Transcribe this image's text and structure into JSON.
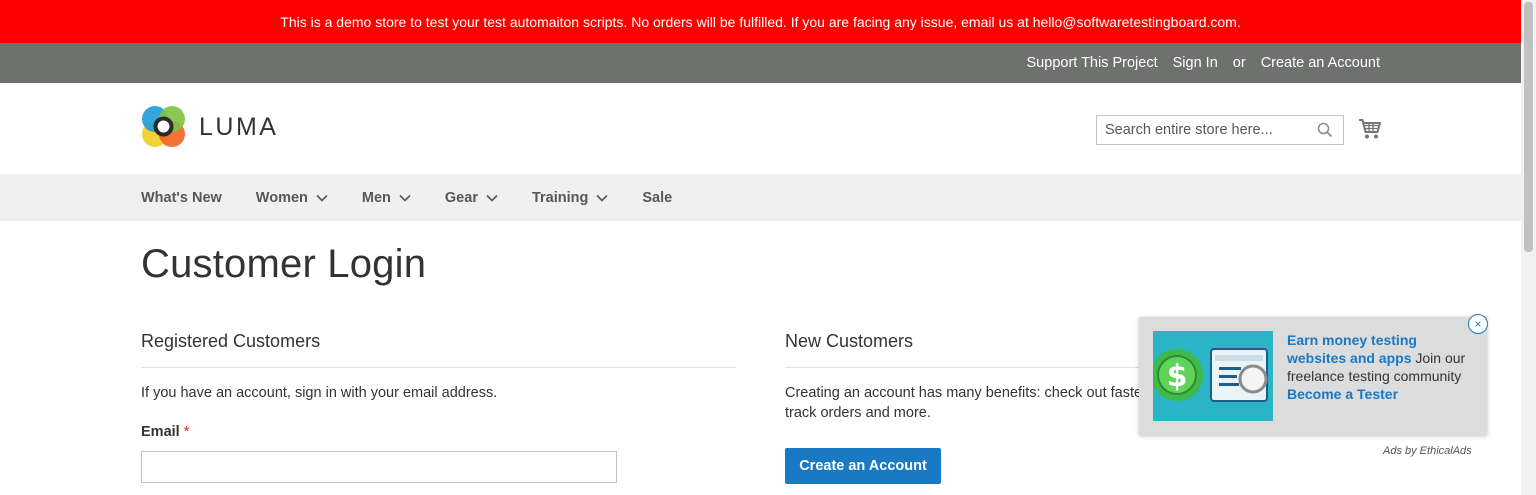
{
  "demo_notice": "This is a demo store to test your test automaiton scripts. No orders will be fulfilled. If you are facing any issue, email us at hello@softwaretestingboard.com.",
  "header_links": {
    "support": "Support This Project",
    "sign_in": "Sign In",
    "or": "or",
    "create_account": "Create an Account"
  },
  "logo": {
    "text": "LUMA"
  },
  "search": {
    "placeholder": "Search entire store here..."
  },
  "nav": {
    "items": [
      {
        "label": "What's New"
      },
      {
        "label": "Women"
      },
      {
        "label": "Men"
      },
      {
        "label": "Gear"
      },
      {
        "label": "Training"
      },
      {
        "label": "Sale"
      }
    ]
  },
  "page_title": "Customer Login",
  "registered": {
    "title": "Registered Customers",
    "intro": "If you have an account, sign in with your email address.",
    "email_label": "Email",
    "required_mark": "*"
  },
  "new_customers": {
    "title": "New Customers",
    "text": "Creating an account has many benefits: check out faste",
    "text_line2": "track orders and more.",
    "button": "Create an Account"
  },
  "ad": {
    "link_text": "Earn money testing websites and apps",
    "body": " Join our freelance testing community ",
    "cta": "Become a Tester",
    "close": "×",
    "attribution": "Ads by EthicalAds"
  },
  "colors": {
    "demo_bar": "#ff0000",
    "panel_header": "#6e716e",
    "nav_bg": "#f0f0f0",
    "primary_button": "#1979c3"
  }
}
